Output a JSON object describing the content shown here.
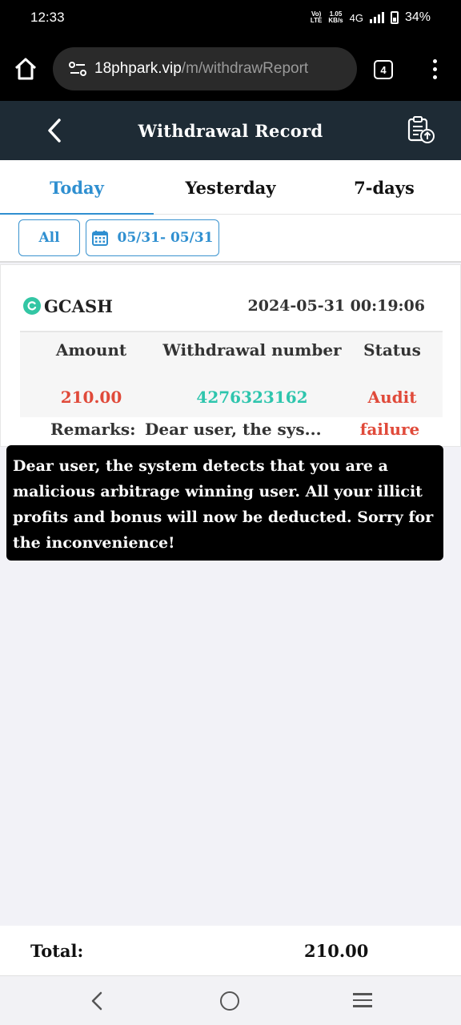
{
  "status_bar": {
    "time": "12:33",
    "volte_top": "Vo)",
    "volte_bottom": "LTE",
    "speed_top": "1.05",
    "speed_bottom": "KB/s",
    "network": "4G",
    "battery": "34%"
  },
  "browser": {
    "url_host": "18phpark.vip",
    "url_path": "/m/withdrawReport",
    "tab_count": "4"
  },
  "header": {
    "title": "Withdrawal Record"
  },
  "tabs": [
    {
      "label": "Today",
      "active": true
    },
    {
      "label": "Yesterday",
      "active": false
    },
    {
      "label": "7-days",
      "active": false
    }
  ],
  "filters": {
    "all_label": "All",
    "date_range": "05/31- 05/31"
  },
  "record": {
    "method": "GCASH",
    "datetime": "2024-05-31 00:19:06",
    "col_amount": "Amount",
    "col_number": "Withdrawal number",
    "col_status": "Status",
    "amount": "210.00",
    "number": "4276323162",
    "status_line1": "Audit",
    "status_line2": "failure",
    "remarks_label": "Remarks:",
    "remarks_preview": "Dear user, the sys..."
  },
  "tooltip": {
    "text": "Dear user, the system detects that you are a malicious arbitrage winning user.  All your illicit profits and bonus will now be deducted. Sorry for the inconvenience!"
  },
  "footer": {
    "total_label": "Total:",
    "total_value": "210.00"
  },
  "colors": {
    "accent": "#2f8fd0",
    "header_bg": "#1e2b35",
    "amount_red": "#e04a3a",
    "number_teal": "#2ec5ad",
    "gcash_green": "#33c6a4"
  }
}
